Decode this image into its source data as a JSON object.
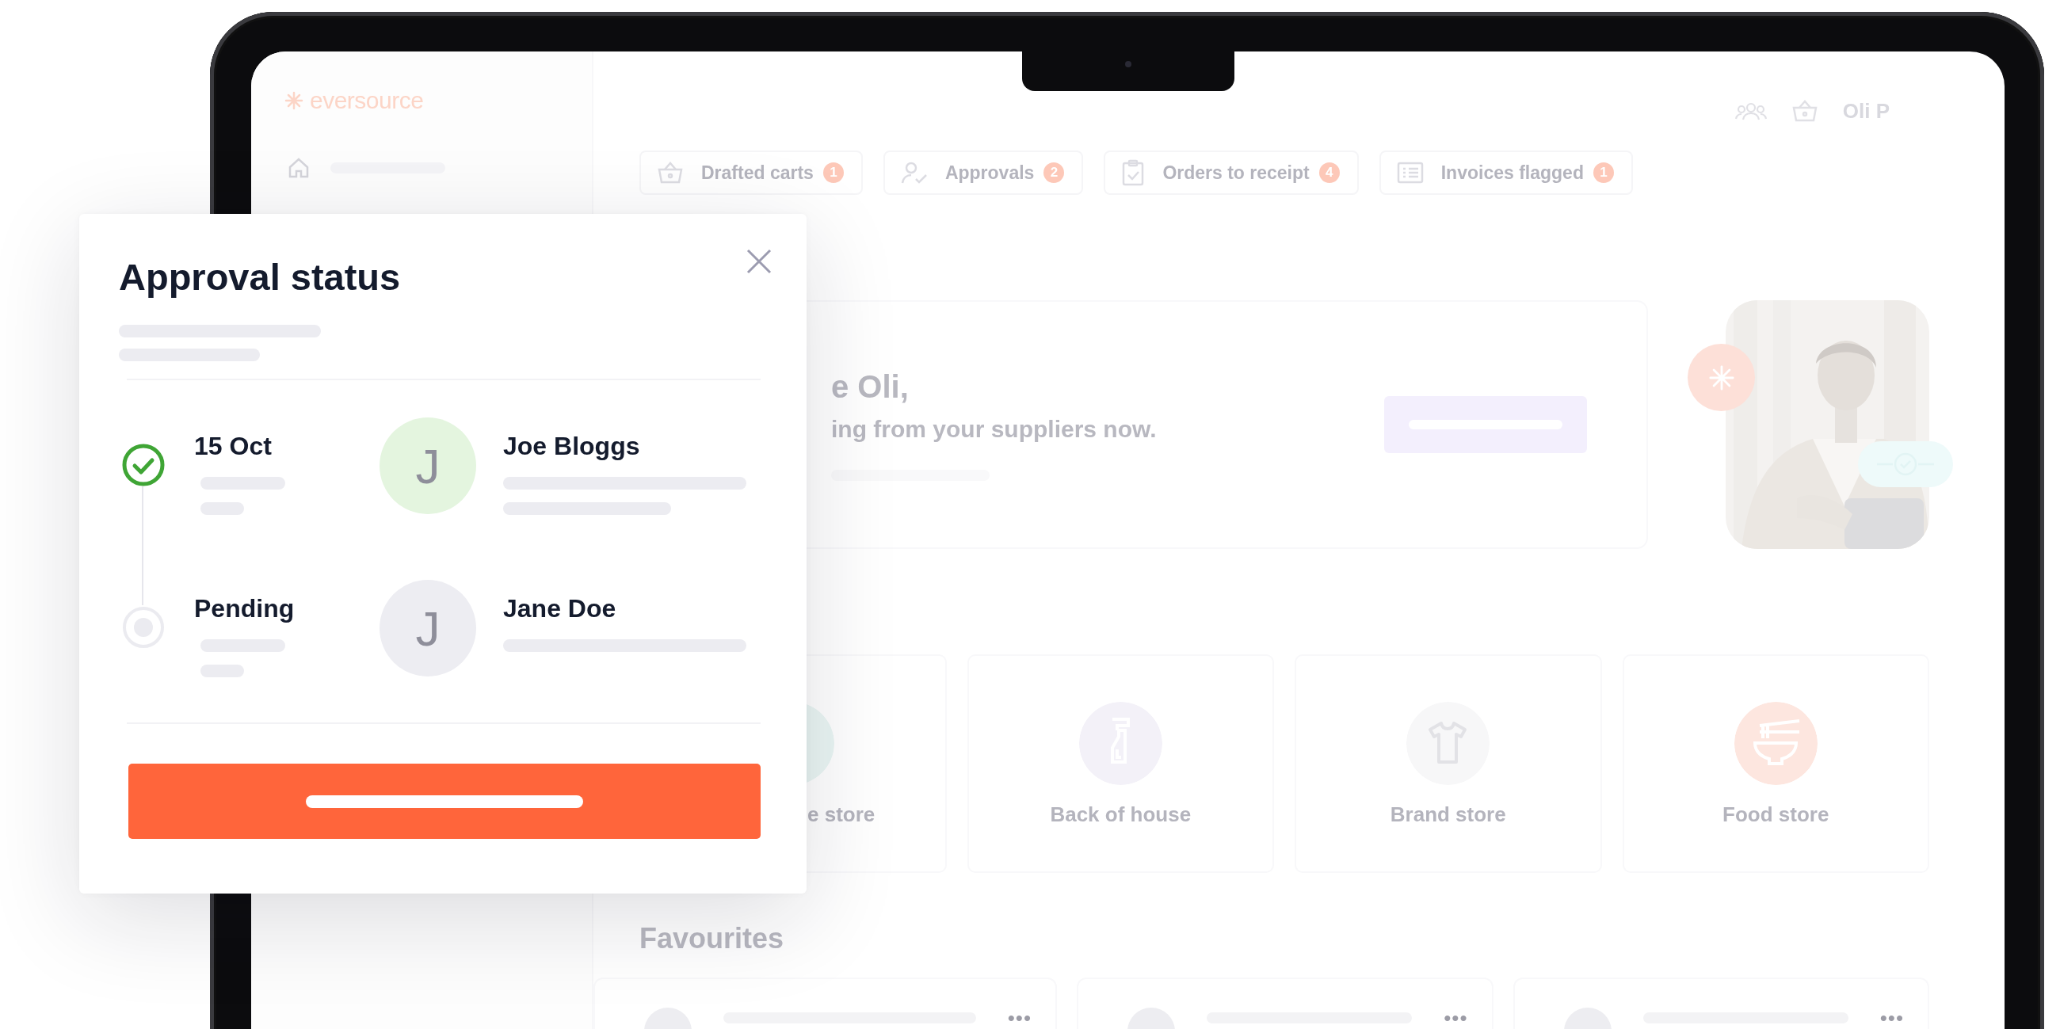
{
  "app": {
    "logo": "eversource",
    "user": "Oli P",
    "chips": [
      {
        "kind": "basket",
        "label": "Drafted carts",
        "count": "1"
      },
      {
        "kind": "approval",
        "label": "Approvals",
        "count": "2"
      },
      {
        "kind": "clipboard",
        "label": "Orders to receipt",
        "count": "4"
      },
      {
        "kind": "invoice",
        "label": "Invoices flagged",
        "count": "1"
      }
    ],
    "hero": {
      "greeting": "e Oli,",
      "subtitle": "ing from your suppliers now."
    },
    "categories": [
      {
        "kind": "hidden",
        "label": "e store",
        "color": "#eaf6f4"
      },
      {
        "kind": "bottle",
        "label": "Back of house",
        "color": "#f3f1f8"
      },
      {
        "kind": "shirt",
        "label": "Brand store",
        "color": "#f7f7f8"
      },
      {
        "kind": "bowl",
        "label": "Food store",
        "color": "#fde6df"
      }
    ],
    "favourites": {
      "title": "Favourites",
      "cards": [
        {
          "menu": "•••"
        },
        {
          "menu": "•••"
        },
        {
          "menu": "•••"
        }
      ]
    }
  },
  "modal": {
    "title": "Approval status",
    "steps": [
      {
        "label": "15 Oct",
        "done": true,
        "initial": "J",
        "name": "Joe Bloggs",
        "color": "#e4f5df"
      },
      {
        "label": "Pending",
        "done": false,
        "initial": "J",
        "name": "Jane Doe",
        "color": "#ededf2"
      }
    ]
  }
}
